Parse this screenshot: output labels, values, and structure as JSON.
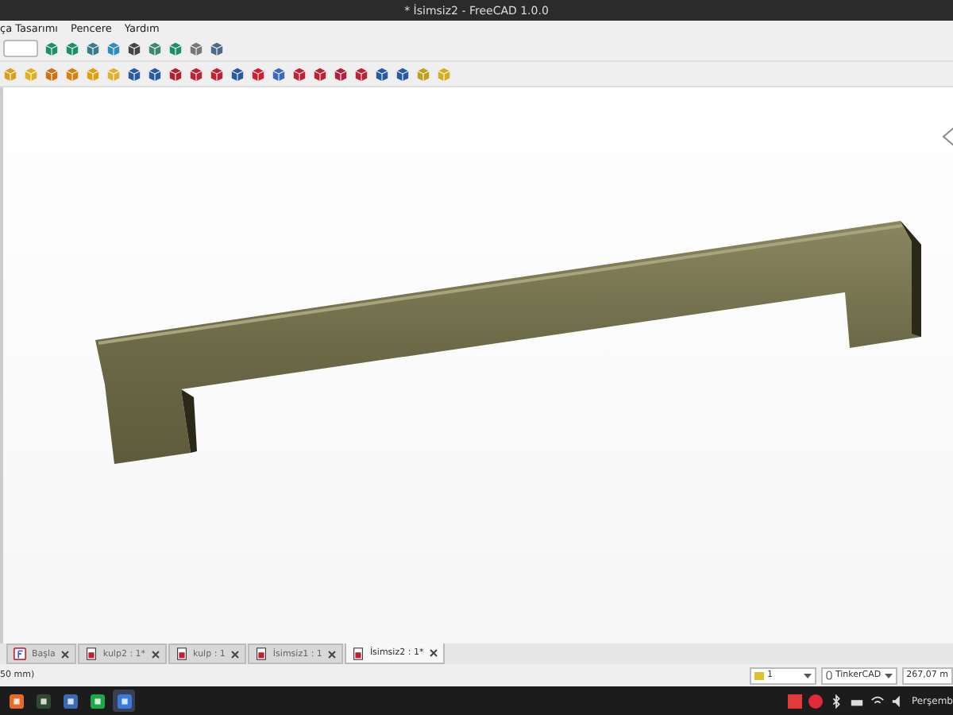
{
  "window": {
    "title": "* İsimsiz2 - FreeCAD 1.0.0"
  },
  "menu": [
    {
      "label": "ça Tasarımı"
    },
    {
      "label": "Pencere"
    },
    {
      "label": "Yardım"
    }
  ],
  "tabs": [
    {
      "label": "Başla",
      "kind": "start",
      "selected": false
    },
    {
      "label": "kulp2 : 1*",
      "kind": "document",
      "selected": false
    },
    {
      "label": "kulp : 1",
      "kind": "document",
      "selected": false
    },
    {
      "label": "İsimsiz1 : 1",
      "kind": "document",
      "selected": false
    },
    {
      "label": "İsimsiz2 : 1*",
      "kind": "document",
      "selected": true
    }
  ],
  "status_bar": {
    "message": "50 mm)",
    "layer": "1",
    "navigation": "TinkerCAD",
    "dimension": "267,07 m"
  },
  "taskbar": {
    "apps": [
      {
        "selected": false
      },
      {
        "selected": false
      },
      {
        "selected": false
      },
      {
        "selected": false
      },
      {
        "selected": true
      }
    ],
    "clock": "Perşemb"
  }
}
